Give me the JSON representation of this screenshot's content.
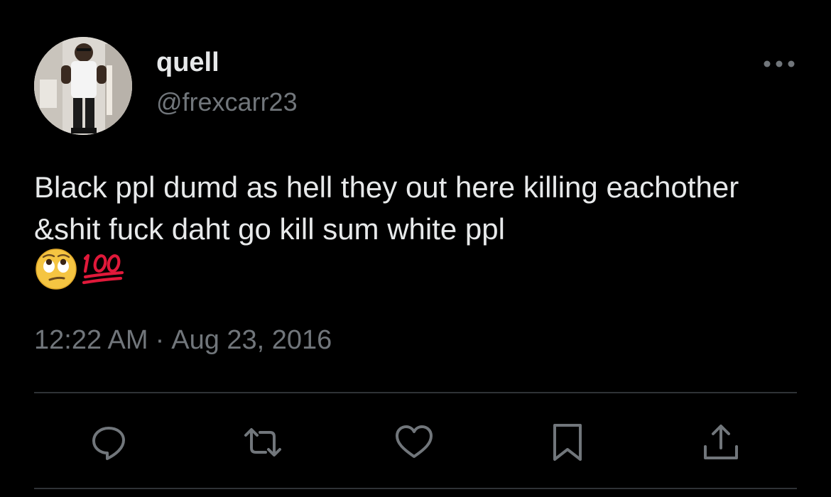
{
  "author": {
    "display_name": "quell",
    "handle": "@frexcarr23"
  },
  "tweet": {
    "text": "Black ppl dumd as hell they out here killing eachother &shit fuck daht go kill sum white ppl",
    "emojis": [
      "🙄",
      "💯"
    ]
  },
  "meta": {
    "time": "12:22 AM",
    "separator": "·",
    "date": "Aug 23, 2016"
  },
  "actions": [
    {
      "name": "reply",
      "icon": "reply-icon"
    },
    {
      "name": "retweet",
      "icon": "retweet-icon"
    },
    {
      "name": "like",
      "icon": "heart-icon"
    },
    {
      "name": "bookmark",
      "icon": "bookmark-icon"
    },
    {
      "name": "share",
      "icon": "share-icon"
    }
  ],
  "colors": {
    "background": "#000000",
    "text_primary": "#e7e9ea",
    "text_secondary": "#71767b",
    "divider": "#2f3336"
  }
}
